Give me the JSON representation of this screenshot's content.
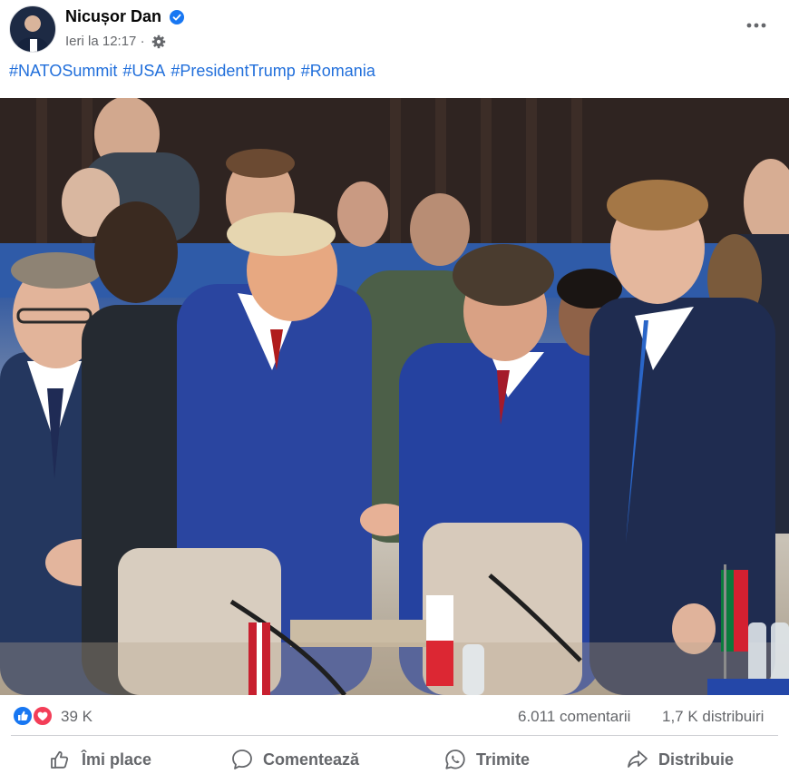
{
  "post": {
    "author": "Nicușor Dan",
    "time": "Ieri la 12:17",
    "separator": "·",
    "hashtags": [
      "#NATOSummit",
      "#USA",
      "#PresidentTrump",
      "#Romania"
    ]
  },
  "icons": {
    "verified": "verified-badge-icon",
    "audience": "gear-icon",
    "more": "more-options-icon",
    "like": "like-reaction-icon",
    "love": "love-reaction-icon"
  },
  "colors": {
    "hashtag": "#216fdb",
    "verified": "#1877f2",
    "like": "#1877f2",
    "love": "#f33e58",
    "muted": "#65676b"
  },
  "stats": {
    "reactions": "39 K",
    "comments": "6.011 comentarii",
    "shares": "1,7 K distribuiri"
  },
  "actions": {
    "like": "Îmi place",
    "comment": "Comentează",
    "send": "Trimite",
    "share": "Distribuie"
  }
}
